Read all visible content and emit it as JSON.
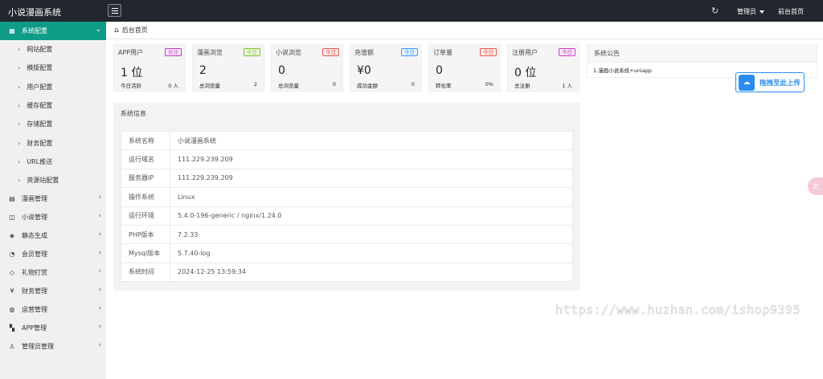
{
  "app": {
    "title": "小说漫画系统"
  },
  "topbar": {
    "admin_label": "管理员",
    "front_label": "前台首页"
  },
  "breadcrumb": {
    "label": "后台首页"
  },
  "sidebar": {
    "groups": [
      {
        "label": "系统配置",
        "icon": "settings-icon",
        "expanded": true
      },
      {
        "label": "漫画管理",
        "icon": "book-icon"
      },
      {
        "label": "小说管理",
        "icon": "reader-icon"
      },
      {
        "label": "静态生成",
        "icon": "layers-icon"
      },
      {
        "label": "会员管理",
        "icon": "user-icon"
      },
      {
        "label": "礼物打赏",
        "icon": "diamond-icon"
      },
      {
        "label": "财务管理",
        "icon": "yen-icon"
      },
      {
        "label": "运营管理",
        "icon": "globe-icon"
      },
      {
        "label": "APP管理",
        "icon": "windows-icon"
      },
      {
        "label": "管理员管理",
        "icon": "admin-icon"
      }
    ],
    "sub_items": [
      "网站配置",
      "模版配置",
      "用户配置",
      "缓存配置",
      "存储配置",
      "财务配置",
      "URL推送",
      "资源站配置"
    ]
  },
  "stats": [
    {
      "title": "APP用户",
      "badge": "合计",
      "badge_color": "#c03fc0",
      "value": "1 位",
      "foot_label": "今日活跃",
      "foot_value": "0 人"
    },
    {
      "title": "漫画浏览",
      "badge": "今日",
      "badge_color": "#7bbf2a",
      "value": "2",
      "foot_label": "总浏览量",
      "foot_value": "2"
    },
    {
      "title": "小说浏览",
      "badge": "今日",
      "badge_color": "#e0574f",
      "value": "0",
      "foot_label": "总浏览量",
      "foot_value": "0"
    },
    {
      "title": "充值额",
      "badge": "今日",
      "badge_color": "#3b9bf0",
      "value": "¥0",
      "foot_label": "成功金额",
      "foot_value": "0"
    },
    {
      "title": "订单量",
      "badge": "今日",
      "badge_color": "#e0574f",
      "value": "0",
      "foot_label": "转化率",
      "foot_value": "0%"
    },
    {
      "title": "注册用户",
      "badge": "今日",
      "badge_color": "#c03fc0",
      "value": "0 位",
      "foot_label": "总注册",
      "foot_value": "1 人"
    }
  ],
  "notice": {
    "title": "系统公告",
    "items": [
      "1.漫画小说系统+uniapp"
    ]
  },
  "sysinfo": {
    "title": "系统信息",
    "rows": [
      {
        "key": "系统名称",
        "value": "小说漫画系统"
      },
      {
        "key": "运行域名",
        "value": "111.229.239.209"
      },
      {
        "key": "服务器IP",
        "value": "111.229.239.209"
      },
      {
        "key": "操作系统",
        "value": "Linux"
      },
      {
        "key": "运行环境",
        "value": "5.4.0-196-generic / nginx/1.24.0"
      },
      {
        "key": "PHP版本",
        "value": "7.2.33"
      },
      {
        "key": "Mysql版本",
        "value": "5.7.40-log"
      },
      {
        "key": "系统时间",
        "value": "2024-12-25 13:59:34"
      }
    ]
  },
  "upload_widget": {
    "label": "拖拽至此上传"
  },
  "watermark": {
    "text": "https://www.huzhan.com/ishop9395"
  }
}
